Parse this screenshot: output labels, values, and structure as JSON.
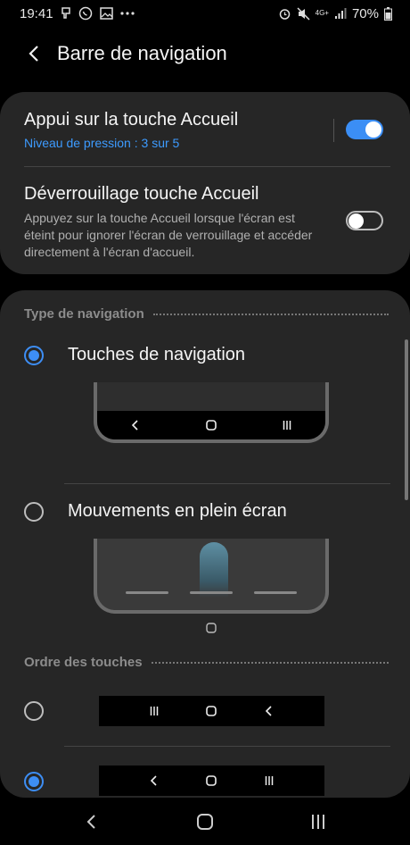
{
  "status_bar": {
    "time": "19:41",
    "battery": "70%",
    "network": "4G+"
  },
  "header": {
    "title": "Barre de navigation",
    "back_icon": "back-arrow-icon"
  },
  "settings": {
    "home_press": {
      "title": "Appui sur la touche Accueil",
      "subtitle": "Niveau de pression : 3 sur 5",
      "enabled": true
    },
    "home_unlock": {
      "title": "Déverrouillage touche Accueil",
      "description": "Appuyez sur la touche Accueil lorsque l'écran est éteint pour ignorer l'écran de verrouillage et accéder directement à l'écran d'accueil.",
      "enabled": false
    }
  },
  "navigation_type": {
    "section_title": "Type de navigation",
    "options": [
      {
        "label": "Touches de navigation",
        "selected": true
      },
      {
        "label": "Mouvements en plein écran",
        "selected": false
      }
    ]
  },
  "button_order": {
    "section_title": "Ordre des touches",
    "options": [
      {
        "icons": [
          "recents-icon",
          "home-icon",
          "back-icon"
        ],
        "selected": false
      },
      {
        "icons": [
          "back-icon",
          "home-icon",
          "recents-icon"
        ],
        "selected": true
      }
    ]
  },
  "colors": {
    "accent": "#3d8ef5",
    "card": "#262626",
    "background": "#000000"
  }
}
